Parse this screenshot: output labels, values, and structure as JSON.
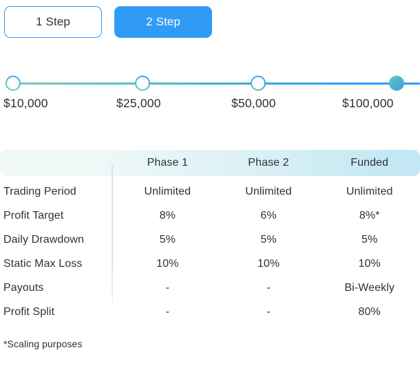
{
  "tabs": {
    "items": [
      {
        "label": "1 Step",
        "active": false
      },
      {
        "label": "2 Step",
        "active": true
      }
    ]
  },
  "slider": {
    "steps": [
      {
        "label": "$10,000",
        "selected": false
      },
      {
        "label": "$25,000",
        "selected": false
      },
      {
        "label": "$50,000",
        "selected": false
      },
      {
        "label": "$100,000",
        "selected": true
      }
    ],
    "track_gradient_from": "#6fcfae",
    "track_gradient_to": "#2f9bf5"
  },
  "table": {
    "headers": [
      "",
      "Phase 1",
      "Phase 2",
      "Funded"
    ],
    "rows": [
      {
        "label": "Trading Period",
        "values": [
          "Unlimited",
          "Unlimited",
          "Unlimited"
        ]
      },
      {
        "label": "Profit Target",
        "values": [
          "8%",
          "6%",
          "8%*"
        ]
      },
      {
        "label": "Daily Drawdown",
        "values": [
          "5%",
          "5%",
          "5%"
        ]
      },
      {
        "label": "Static Max Loss",
        "values": [
          "10%",
          "10%",
          "10%"
        ]
      },
      {
        "label": "Payouts",
        "values": [
          "-",
          "-",
          "Bi-Weekly"
        ]
      },
      {
        "label": "Profit Split",
        "values": [
          "-",
          "-",
          "80%"
        ]
      }
    ]
  },
  "footnote": "*Scaling purposes",
  "colors": {
    "accent_blue": "#2f9bf5",
    "accent_teal": "#62c9b6",
    "header_band_left": "#f1f9f6",
    "header_band_right": "#c2e8f3",
    "divider": "#cfe9f3",
    "text": "#2c3138"
  }
}
